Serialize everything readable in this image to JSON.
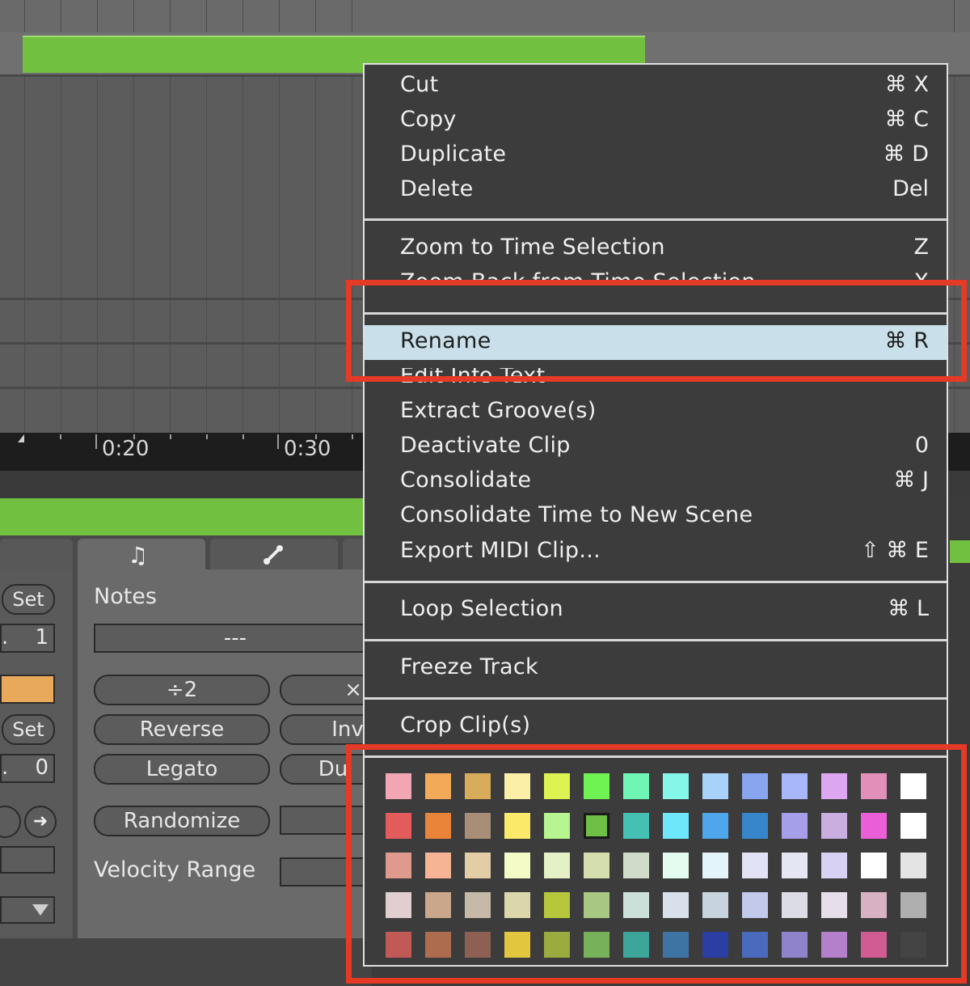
{
  "ruler": {
    "labels": [
      "0:20",
      "0:30"
    ]
  },
  "clip": {
    "color": "#72c040"
  },
  "panel": {
    "tab_icons": [
      "music-note-icon",
      "envelope-icon"
    ],
    "notes_label": "Notes",
    "notes_value": "---",
    "left_set_1": "Set",
    "left_val_1": "1",
    "left_set_2": "Set",
    "left_val_2": "0",
    "left_prefix_1": ".",
    "left_prefix_2": ".",
    "buttons": {
      "div2": "÷2",
      "times2": "×",
      "reverse": "Reverse",
      "invert": "Inv",
      "legato": "Legato",
      "duplicate": "Du",
      "randomize": "Randomize"
    },
    "velocity_range_label": "Velocity Range",
    "accent_orange": "#e9a95a"
  },
  "menu": {
    "group1": [
      {
        "label": "Cut",
        "shortcut": "⌘ X"
      },
      {
        "label": "Copy",
        "shortcut": "⌘ C"
      },
      {
        "label": "Duplicate",
        "shortcut": "⌘ D"
      },
      {
        "label": "Delete",
        "shortcut": "Del"
      }
    ],
    "group2": [
      {
        "label": "Zoom to Time Selection",
        "shortcut": "Z"
      },
      {
        "label": "Zoom Back from Time Selection",
        "shortcut": "X"
      }
    ],
    "group3": [
      {
        "label": "Rename",
        "shortcut": "⌘ R",
        "highlighted": true
      },
      {
        "label": "Edit Info Text",
        "shortcut": ""
      },
      {
        "label": "Extract Groove(s)",
        "shortcut": ""
      },
      {
        "label": "Deactivate Clip",
        "shortcut": "0"
      },
      {
        "label": "Consolidate",
        "shortcut": "⌘ J"
      },
      {
        "label": "Consolidate Time to New Scene",
        "shortcut": ""
      },
      {
        "label": "Export MIDI Clip...",
        "shortcut": "⇧ ⌘ E"
      }
    ],
    "group4": [
      {
        "label": "Loop Selection",
        "shortcut": "⌘ L"
      }
    ],
    "group5": [
      {
        "label": "Freeze Track",
        "shortcut": ""
      }
    ],
    "group6": [
      {
        "label": "Crop Clip(s)",
        "shortcut": ""
      }
    ],
    "highlight_color": "#c9e0ea",
    "annotation_color": "#e43a26"
  },
  "palette": {
    "selected": "#6ec045",
    "rows": [
      [
        "#f2a6b3",
        "#f2a958",
        "#d9ac5c",
        "#fbefa8",
        "#dcf351",
        "#6ff352",
        "#6ff5b4",
        "#84f7e9",
        "#a8d2fa",
        "#8aa5f0",
        "#a8b7fa",
        "#dca6f0",
        "#e28fba",
        "#ffffff"
      ],
      [
        "#e35b5b",
        "#e98438",
        "#a88e76",
        "#fbea6a",
        "#b6f58f",
        "#6ec045",
        "#45c1b4",
        "#6ee7fb",
        "#4da7ea",
        "#3786cc",
        "#a59ee8",
        "#caaee0",
        "#ea5fd8",
        "#ffffff"
      ],
      [
        "#df9a8d",
        "#f6b495",
        "#e3cda6",
        "#f4fbc6",
        "#e4f1c7",
        "#d5dfae",
        "#d0dcc9",
        "#e4fbef",
        "#e3f4fb",
        "#e2e2f6",
        "#e5e6f4",
        "#d7d1f4",
        "#ffffff",
        "#e4e4e4"
      ],
      [
        "#e1cfcf",
        "#caa68a",
        "#c7b9a8",
        "#dbd7aa",
        "#b7c73b",
        "#a7c783",
        "#cbe0d8",
        "#d7e0eb",
        "#c7d4e0",
        "#c2c9ea",
        "#dcdce6",
        "#e6dfea",
        "#d8b2c3",
        "#afafaf"
      ],
      [
        "#c15a57",
        "#ae6c4f",
        "#8e6053",
        "#e2c63d",
        "#9bab3e",
        "#77b15a",
        "#3ba699",
        "#3e74a3",
        "#2b3ea3",
        "#4a6bbd",
        "#8f84cc",
        "#b47fcb",
        "#d05c93",
        "#444444"
      ]
    ]
  }
}
